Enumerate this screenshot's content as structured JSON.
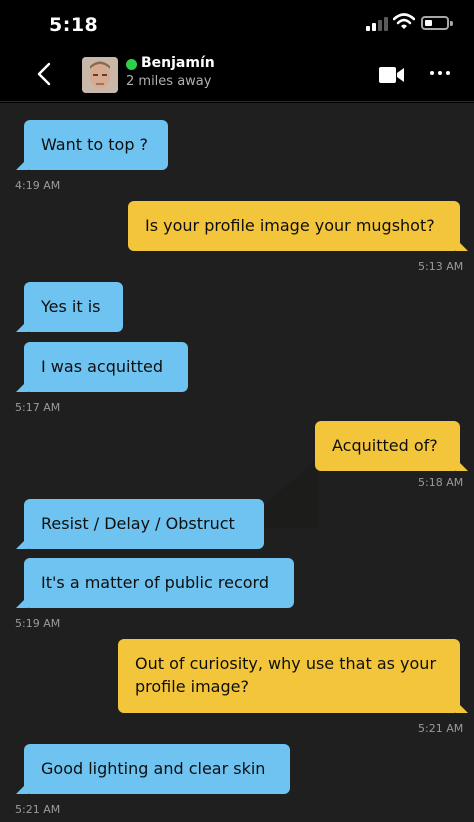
{
  "status_bar": {
    "time": "5:18"
  },
  "header": {
    "name": "Benjamín",
    "distance": "2 miles away"
  },
  "messages": [
    {
      "text": "Want to top ?",
      "side": "in"
    },
    {
      "text": "Is your profile image your mugshot?",
      "side": "out"
    },
    {
      "text": "Yes it is",
      "side": "in"
    },
    {
      "text": "I was acquitted",
      "side": "in"
    },
    {
      "text": "Acquitted of?",
      "side": "out"
    },
    {
      "text": "Resist / Delay / Obstruct",
      "side": "in"
    },
    {
      "text": "It's a matter of public record",
      "side": "in"
    },
    {
      "text": "Out of curiosity, why use that as your profile image?",
      "side": "out"
    },
    {
      "text": "Good lighting and clear skin",
      "side": "in"
    }
  ],
  "timestamps": [
    "4:19 AM",
    "5:13 AM",
    "5:17 AM",
    "5:18 AM",
    "5:19 AM",
    "5:21 AM",
    "5:21 AM"
  ],
  "colors": {
    "incoming": "#6ec3f0",
    "outgoing": "#f3c53a",
    "background": "#1f1f1f",
    "online": "#2fcf4a"
  },
  "icons": [
    "back-chevron-icon",
    "online-dot-icon",
    "video-call-icon",
    "more-options-icon"
  ]
}
